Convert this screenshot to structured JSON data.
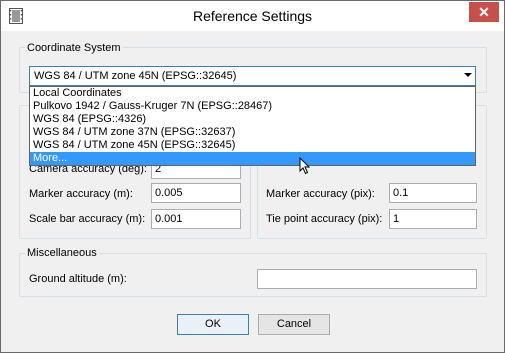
{
  "window": {
    "title": "Reference Settings",
    "close_glyph": "✕"
  },
  "coordinate_system": {
    "group_title": "Coordinate System",
    "selected": "WGS 84 / UTM zone 45N (EPSG::32645)",
    "options": [
      "Local Coordinates",
      "Pulkovo 1942 / Gauss-Kruger 7N (EPSG::28467)",
      "WGS 84 (EPSG::4326)",
      "WGS 84 / UTM zone 37N (EPSG::32637)",
      "WGS 84 / UTM zone 45N (EPSG::32645)",
      "More..."
    ],
    "highlighted_option": "More..."
  },
  "left_fields": {
    "camera_accuracy_label": "Camera accuracy (deg):",
    "camera_accuracy_value": "2",
    "marker_accuracy_label": "Marker accuracy (m):",
    "marker_accuracy_value": "0.005",
    "scale_bar_accuracy_label": "Scale bar accuracy (m):",
    "scale_bar_accuracy_value": "0.001"
  },
  "right_fields": {
    "marker_accuracy_label": "Marker accuracy (pix):",
    "marker_accuracy_value": "0.1",
    "tie_point_accuracy_label": "Tie point accuracy (pix):",
    "tie_point_accuracy_value": "1"
  },
  "miscellaneous": {
    "group_title": "Miscellaneous",
    "ground_altitude_label": "Ground altitude (m):",
    "ground_altitude_value": ""
  },
  "buttons": {
    "ok": "OK",
    "cancel": "Cancel"
  },
  "colors": {
    "selection": "#3399ff",
    "close_button": "#c7504a",
    "accent_border": "#3c7fb1"
  },
  "icons": {
    "app": "film-strip-icon",
    "close": "close-icon",
    "dropdown": "chevron-down-icon",
    "cursor": "mouse-pointer-icon"
  }
}
